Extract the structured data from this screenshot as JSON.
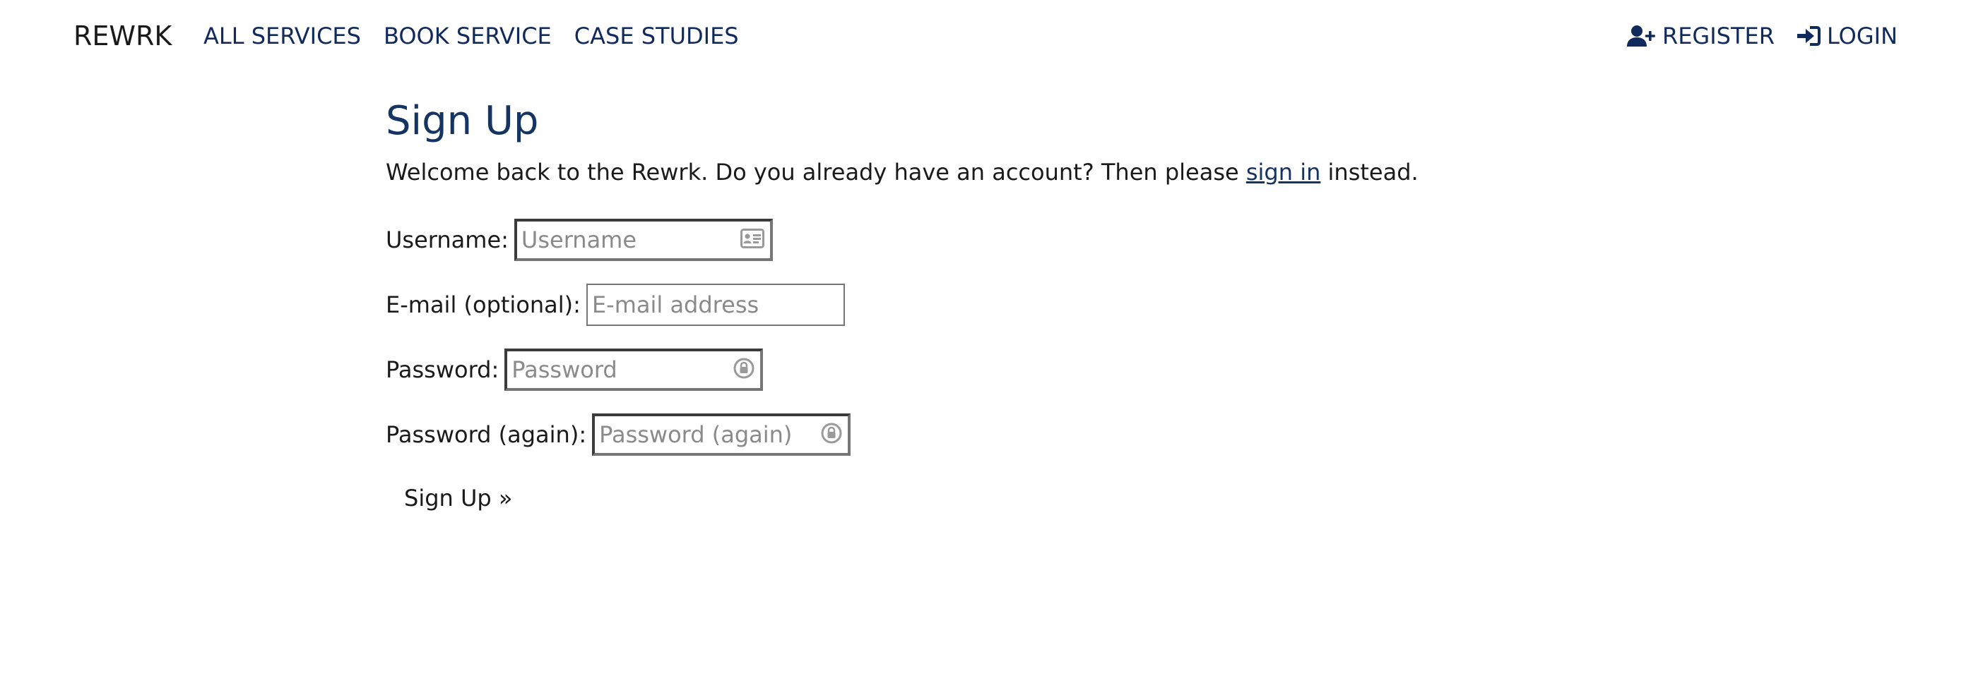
{
  "nav": {
    "brand": "REWRK",
    "left_links": [
      {
        "label": "ALL SERVICES"
      },
      {
        "label": "BOOK SERVICE"
      },
      {
        "label": "CASE STUDIES"
      }
    ],
    "right_links": [
      {
        "label": "REGISTER",
        "icon": "user-plus-icon"
      },
      {
        "label": "LOGIN",
        "icon": "sign-in-icon"
      }
    ]
  },
  "page": {
    "title": "Sign Up",
    "intro_before": "Welcome back to the Rewrk. Do you already have an account? Then please ",
    "intro_link": "sign in",
    "intro_after": " instead."
  },
  "form": {
    "username": {
      "label": "Username:",
      "placeholder": "Username",
      "icon": "contact-card-icon"
    },
    "email": {
      "label": "E-mail (optional):",
      "placeholder": "E-mail address"
    },
    "password": {
      "label": "Password:",
      "placeholder": "Password",
      "icon": "password-key-icon"
    },
    "password2": {
      "label": "Password (again):",
      "placeholder": "Password (again)",
      "icon": "password-key-icon"
    },
    "submit_label": "Sign Up »"
  },
  "colors": {
    "nav_link": "#102a5c",
    "heading": "#153461",
    "text": "#1a1a1a"
  }
}
